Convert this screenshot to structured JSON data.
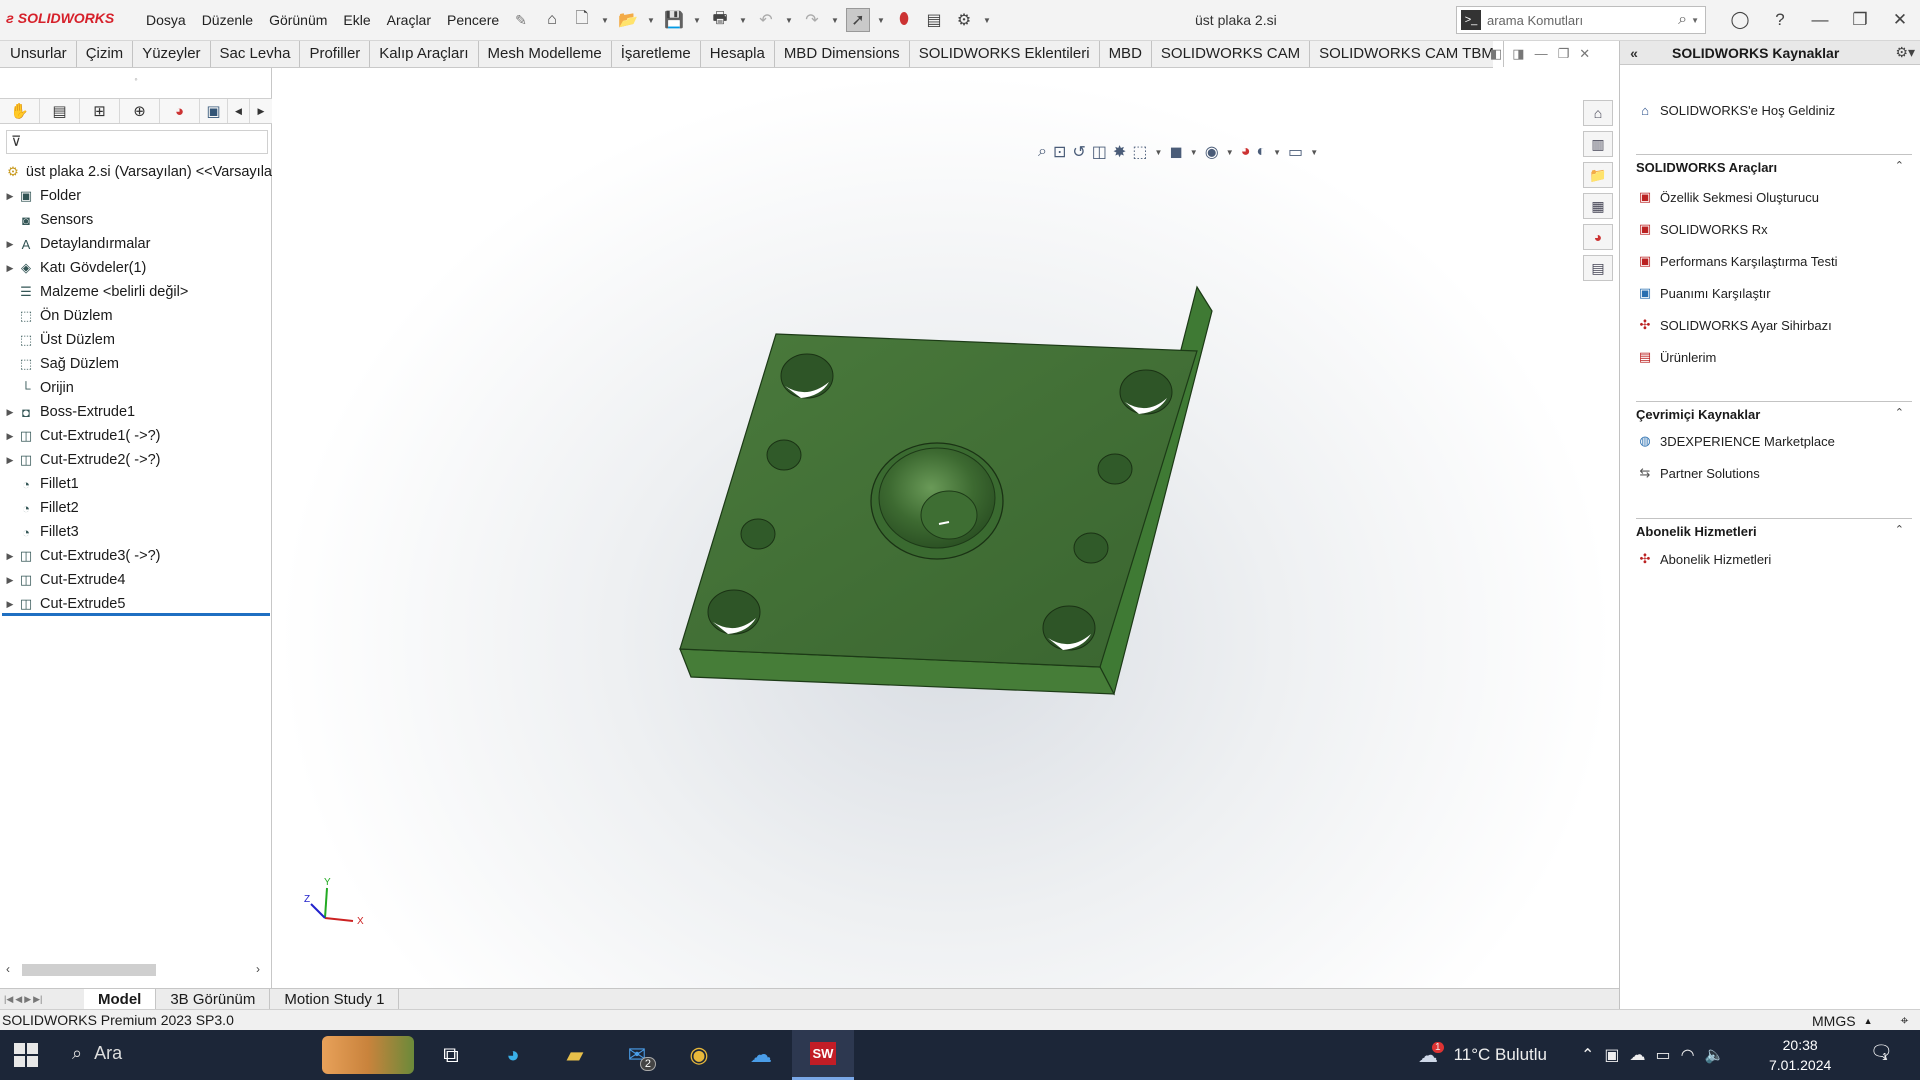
{
  "app": {
    "brand": "SOLIDWORKS",
    "document_title": "üst plaka 2.si",
    "accent": "#d6202a"
  },
  "menu": [
    "Dosya",
    "Düzenle",
    "Görünüm",
    "Ekle",
    "Araçlar",
    "Pencere"
  ],
  "search": {
    "placeholder": "arama Komutları"
  },
  "command_tabs": [
    "Unsurlar",
    "Çizim",
    "Yüzeyler",
    "Sac Levha",
    "Profiller",
    "Kalıp Araçları",
    "Mesh Modelleme",
    "İşaretleme",
    "Hesapla",
    "MBD Dimensions",
    "SOLIDWORKS Eklentileri",
    "MBD",
    "SOLIDWORKS CAM",
    "SOLIDWORKS CAM TBM"
  ],
  "feature_tree": {
    "root": "üst plaka 2.si (Varsayılan) <<Varsayıla",
    "items": [
      {
        "label": "Folder",
        "expand": true,
        "icon": "folder-icon"
      },
      {
        "label": "Sensors",
        "expand": false,
        "icon": "sensor-icon"
      },
      {
        "label": "Detaylandırmalar",
        "expand": true,
        "icon": "annotation-icon"
      },
      {
        "label": "Katı Gövdeler(1)",
        "expand": true,
        "icon": "solid-body-icon"
      },
      {
        "label": "Malzeme <belirli değil>",
        "expand": false,
        "icon": "material-icon"
      },
      {
        "label": "Ön Düzlem",
        "expand": false,
        "icon": "plane-icon"
      },
      {
        "label": "Üst Düzlem",
        "expand": false,
        "icon": "plane-icon"
      },
      {
        "label": "Sağ Düzlem",
        "expand": false,
        "icon": "plane-icon"
      },
      {
        "label": "Orijin",
        "expand": false,
        "icon": "origin-icon"
      },
      {
        "label": "Boss-Extrude1",
        "expand": true,
        "icon": "extrude-icon"
      },
      {
        "label": "Cut-Extrude1( ->?)",
        "expand": true,
        "icon": "cut-extrude-icon"
      },
      {
        "label": "Cut-Extrude2( ->?)",
        "expand": true,
        "icon": "cut-extrude-icon"
      },
      {
        "label": "Fillet1",
        "expand": false,
        "icon": "fillet-icon"
      },
      {
        "label": "Fillet2",
        "expand": false,
        "icon": "fillet-icon"
      },
      {
        "label": "Fillet3",
        "expand": false,
        "icon": "fillet-icon"
      },
      {
        "label": "Cut-Extrude3( ->?)",
        "expand": true,
        "icon": "cut-extrude-icon"
      },
      {
        "label": "Cut-Extrude4",
        "expand": true,
        "icon": "cut-extrude-icon"
      },
      {
        "label": "Cut-Extrude5",
        "expand": true,
        "icon": "cut-extrude-icon"
      }
    ]
  },
  "model": {
    "color": "#3f6b33",
    "edge_color": "#1c3a16"
  },
  "triad": {
    "x": "X",
    "y": "Y",
    "z": "Z"
  },
  "task_pane": {
    "title": "SOLIDWORKS Kaynaklar",
    "welcome": "SOLIDWORKS'e Hoş Geldiniz",
    "sections": [
      {
        "title": "SOLIDWORKS Araçları",
        "items": [
          "Özellik Sekmesi Oluşturucu",
          "SOLIDWORKS Rx",
          "Performans Karşılaştırma Testi",
          "Puanımı Karşılaştır",
          "SOLIDWORKS Ayar Sihirbazı",
          "Ürünlerim"
        ]
      },
      {
        "title": "Çevrimiçi Kaynaklar",
        "items": [
          "3DEXPERIENCE Marketplace",
          "Partner Solutions"
        ]
      },
      {
        "title": "Abonelik Hizmetleri",
        "items": [
          "Abonelik Hizmetleri"
        ]
      }
    ]
  },
  "bottom_tabs": [
    "Model",
    "3B Görünüm",
    "Motion Study 1"
  ],
  "status": {
    "left": "SOLIDWORKS Premium 2023 SP3.0",
    "units": "MMGS"
  },
  "taskbar": {
    "search_label": "Ara",
    "weather": "11°C Bulutlu",
    "weather_badge": "1",
    "time": "20:38",
    "date": "7.01.2024",
    "mail_badge": "2",
    "notif_badge": "1"
  }
}
